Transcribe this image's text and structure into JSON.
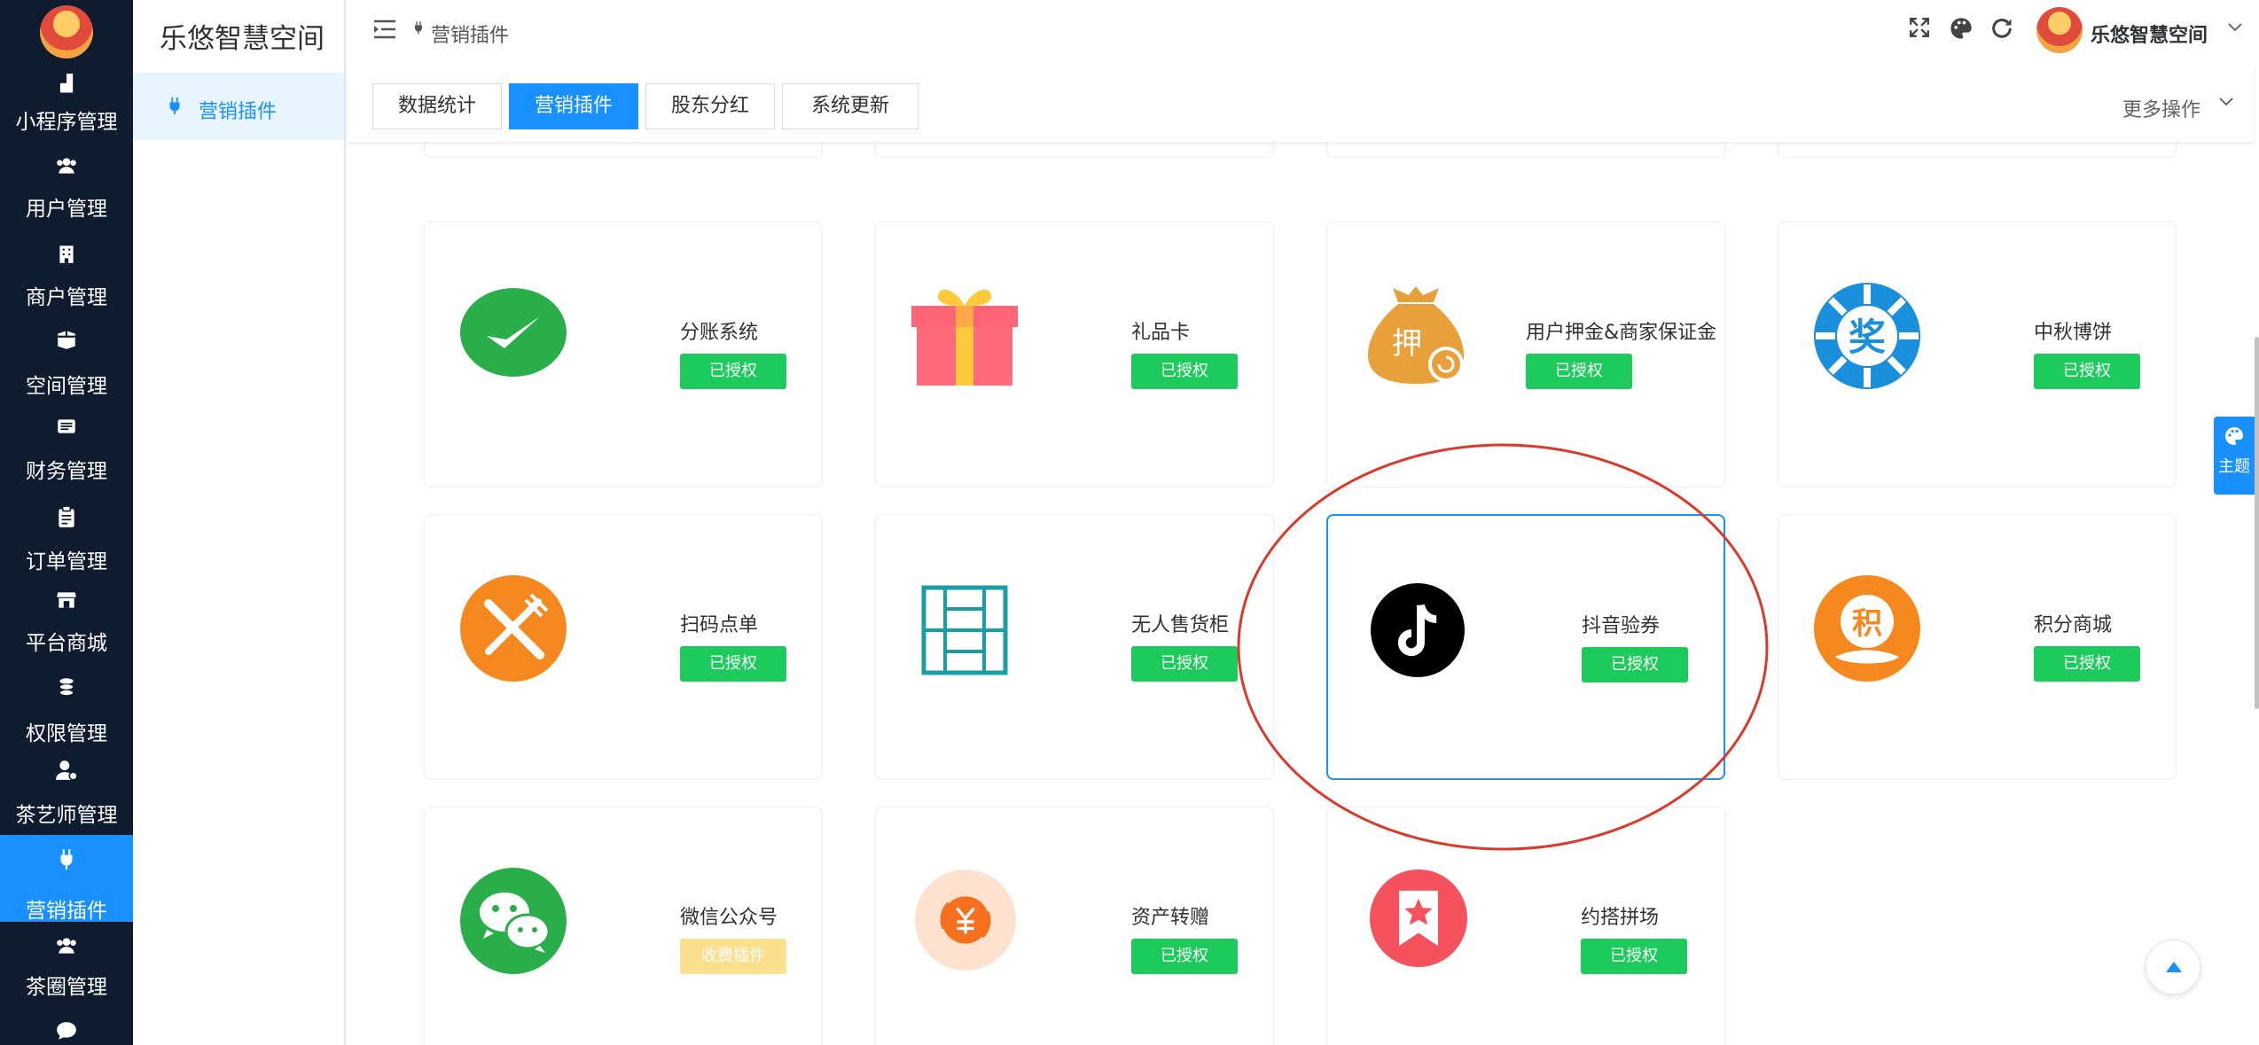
{
  "sidebar": {
    "logo_icon": "brand-logo",
    "items": [
      {
        "label": "小程序管理",
        "icon": "bar-chart-icon"
      },
      {
        "label": "用户管理",
        "icon": "users-icon"
      },
      {
        "label": "商户管理",
        "icon": "building-icon"
      },
      {
        "label": "空间管理",
        "icon": "box-icon"
      },
      {
        "label": "财务管理",
        "icon": "ledger-icon"
      },
      {
        "label": "订单管理",
        "icon": "clipboard-icon"
      },
      {
        "label": "平台商城",
        "icon": "store-icon"
      },
      {
        "label": "权限管理",
        "icon": "coins-icon"
      },
      {
        "label": "茶艺师管理",
        "icon": "user-gear-icon"
      },
      {
        "label": "营销插件",
        "icon": "plug-icon",
        "active": true
      },
      {
        "label": "茶圈管理",
        "icon": "users-icon"
      }
    ]
  },
  "subsidebar": {
    "title": "乐悠智慧空间",
    "item": "营销插件"
  },
  "header": {
    "breadcrumb": "营销插件",
    "user_name": "乐悠智慧空间"
  },
  "tabs": [
    "数据统计",
    "营销插件",
    "股东分红",
    "系统更新"
  ],
  "active_tab": 1,
  "more_ops": "更多操作",
  "theme_label": "主题",
  "plugins": [
    {
      "name": "分账系统",
      "status": "已授权",
      "icon": "wechat-check-icon"
    },
    {
      "name": "礼品卡",
      "status": "已授权",
      "icon": "gift-icon"
    },
    {
      "name": "用户押金&商家保证金",
      "status": "已授权",
      "icon": "deposit-bag-icon"
    },
    {
      "name": "中秋博饼",
      "status": "已授权",
      "icon": "prize-icon"
    },
    {
      "name": "扫码点单",
      "status": "已授权",
      "icon": "fork-knife-icon"
    },
    {
      "name": "无人售货柜",
      "status": "已授权",
      "icon": "vending-cabinet-icon"
    },
    {
      "name": "抖音验券",
      "status": "已授权",
      "icon": "douyin-icon",
      "selected": true
    },
    {
      "name": "积分商城",
      "status": "已授权",
      "icon": "points-icon"
    },
    {
      "name": "微信公众号",
      "status": "收费插件",
      "icon": "wechat-chat-icon"
    },
    {
      "name": "资产转赠",
      "status": "已授权",
      "icon": "yuan-transfer-icon"
    },
    {
      "name": "约搭拼场",
      "status": "已授权",
      "icon": "bookmark-star-icon"
    }
  ],
  "plugin_icon_glyphs": {
    "deposit": "押",
    "prize": "奖",
    "points": "积"
  },
  "colors": {
    "sidebar_bg": "#0f1b2e",
    "accent": "#1890ff",
    "authorized": "#1ccb5c",
    "paid": "#fbe08e",
    "highlight": "#d93a2b"
  }
}
